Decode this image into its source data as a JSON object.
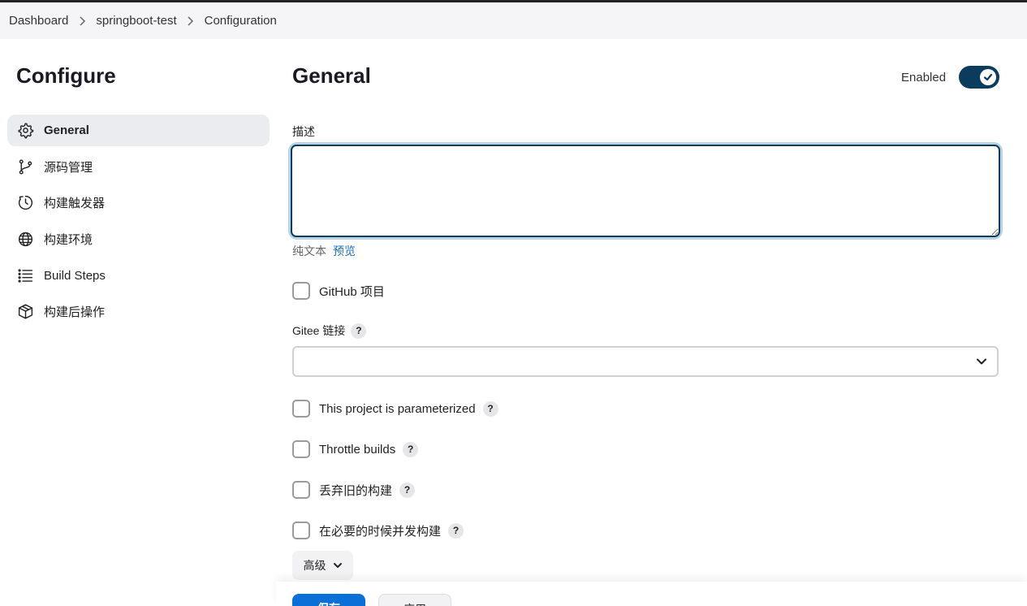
{
  "breadcrumb": {
    "items": [
      "Dashboard",
      "springboot-test",
      "Configuration"
    ]
  },
  "sidebar": {
    "title": "Configure",
    "items": [
      {
        "label": "General",
        "icon": "gear-icon",
        "active": true
      },
      {
        "label": "源码管理",
        "icon": "branch-icon",
        "active": false
      },
      {
        "label": "构建触发器",
        "icon": "clock-icon",
        "active": false
      },
      {
        "label": "构建环境",
        "icon": "globe-icon",
        "active": false
      },
      {
        "label": "Build Steps",
        "icon": "list-icon",
        "active": false
      },
      {
        "label": "构建后操作",
        "icon": "package-icon",
        "active": false
      }
    ]
  },
  "main": {
    "title": "General",
    "enabled_label": "Enabled",
    "enabled": true,
    "description": {
      "label": "描述",
      "value": "",
      "format_text": "纯文本",
      "preview_link": "预览"
    },
    "github_project": {
      "label": "GitHub 项目",
      "checked": false
    },
    "gitee": {
      "label": "Gitee 链接",
      "help": "?",
      "selected": ""
    },
    "options": [
      {
        "label": "This project is parameterized",
        "help": "?",
        "checked": false
      },
      {
        "label": "Throttle builds",
        "help": "?",
        "checked": false
      },
      {
        "label": "丢弃旧的构建",
        "help": "?",
        "checked": false
      },
      {
        "label": "在必要的时候并发构建",
        "help": "?",
        "checked": false
      }
    ],
    "advanced_label": "高级"
  },
  "footer": {
    "save_label": "保存",
    "apply_label": "应用"
  },
  "colors": {
    "accent": "#0b3c5d",
    "primary_button": "#0a6fd6",
    "link": "#1a6fbe"
  }
}
